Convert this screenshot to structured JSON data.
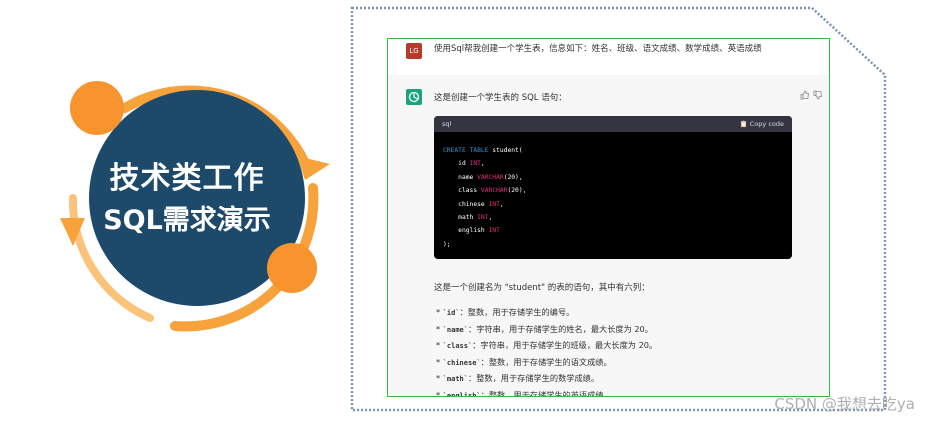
{
  "badge": {
    "line1": "技术类工作",
    "line2": "SQL需求演示",
    "colors": {
      "circle": "#1d4a6b",
      "arc": "#f7a23a",
      "dot": "#f7942e"
    }
  },
  "chat": {
    "user": {
      "avatar": "LG",
      "message": "使用Sql帮我创建一个学生表，信息如下：姓名、班级、语文成绩、数学成绩、英语成绩"
    },
    "assistant": {
      "intro": "这是创建一个学生表的 SQL 语句：",
      "code": {
        "language": "sql",
        "copy_label": "Copy code",
        "lines": [
          {
            "indent": "",
            "parts": [
              {
                "t": "CREATE TABLE",
                "c": "kw"
              },
              {
                "t": " student(",
                "c": ""
              }
            ]
          },
          {
            "indent": "    ",
            "parts": [
              {
                "t": "id ",
                "c": ""
              },
              {
                "t": "INT",
                "c": "ty"
              },
              {
                "t": ",",
                "c": ""
              }
            ]
          },
          {
            "indent": "    ",
            "parts": [
              {
                "t": "name ",
                "c": ""
              },
              {
                "t": "VARCHAR",
                "c": "ty"
              },
              {
                "t": "(20),",
                "c": ""
              }
            ]
          },
          {
            "indent": "    ",
            "parts": [
              {
                "t": "class ",
                "c": ""
              },
              {
                "t": "VARCHAR",
                "c": "ty"
              },
              {
                "t": "(20),",
                "c": ""
              }
            ]
          },
          {
            "indent": "    ",
            "parts": [
              {
                "t": "chinese ",
                "c": ""
              },
              {
                "t": "INT",
                "c": "ty"
              },
              {
                "t": ",",
                "c": ""
              }
            ]
          },
          {
            "indent": "    ",
            "parts": [
              {
                "t": "math ",
                "c": ""
              },
              {
                "t": "INT",
                "c": "ty"
              },
              {
                "t": ",",
                "c": ""
              }
            ]
          },
          {
            "indent": "    ",
            "parts": [
              {
                "t": "english ",
                "c": ""
              },
              {
                "t": "INT",
                "c": "ty"
              }
            ]
          },
          {
            "indent": "",
            "parts": [
              {
                "t": ");",
                "c": ""
              }
            ]
          }
        ]
      },
      "description": "这是一个创建名为 \"student\" 的表的语句，其中有六列：",
      "columns": [
        {
          "name": "`id`",
          "text": "：整数，用于存储学生的编号。"
        },
        {
          "name": "`name`",
          "text": "：字符串，用于存储学生的姓名，最大长度为 20。"
        },
        {
          "name": "`class`",
          "text": "：字符串，用于存储学生的班级，最大长度为 20。"
        },
        {
          "name": "`chinese`",
          "text": "：整数，用于存储学生的语文成绩。"
        },
        {
          "name": "`math`",
          "text": "：整数，用于存储学生的数学成绩。"
        },
        {
          "name": "`english`",
          "text": "：整数，用于存储学生的英语成绩。"
        }
      ],
      "icons": [
        "thumbs-up-icon",
        "thumbs-down-icon",
        "clipboard-icon",
        "openai-logo-icon"
      ]
    }
  },
  "watermark": "CSDN @我想去吃ya"
}
